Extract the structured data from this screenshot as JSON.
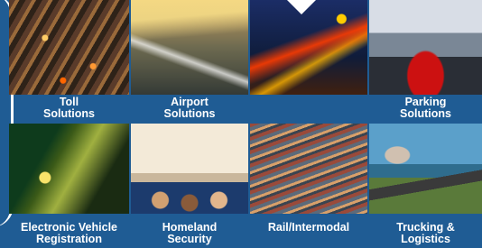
{
  "tiles": [
    {
      "id": "toll",
      "lines": [
        "Toll",
        "Solutions"
      ]
    },
    {
      "id": "airport",
      "lines": [
        "Airport",
        "Solutions"
      ]
    },
    {
      "id": "traffic",
      "lines": []
    },
    {
      "id": "parking",
      "lines": [
        "Parking",
        "Solutions"
      ]
    },
    {
      "id": "evr",
      "lines": [
        "Electronic Vehicle",
        "Registration"
      ]
    },
    {
      "id": "homeland",
      "lines": [
        "Homeland",
        "Security"
      ]
    },
    {
      "id": "rail",
      "lines": [
        "Rail/Intermodal"
      ]
    },
    {
      "id": "trucking",
      "lines": [
        "Trucking &",
        "Logistics"
      ]
    }
  ]
}
